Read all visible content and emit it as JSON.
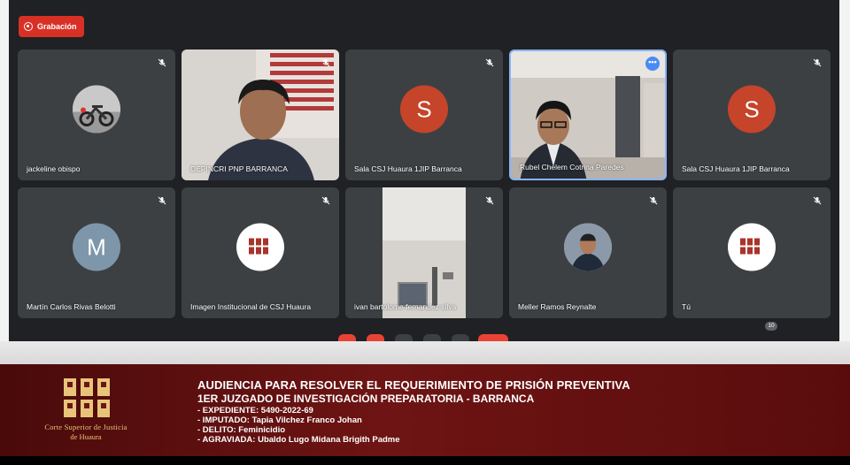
{
  "recording": {
    "label": "Grabación",
    "color": "#d93025"
  },
  "participants": [
    {
      "name": "jackeline obispo",
      "type": "photo-avatar",
      "icon": "motorcycle-photo-icon"
    },
    {
      "name": "DEPINCRI PNP BARRANCA",
      "type": "video"
    },
    {
      "name": "Sala CSJ Huaura 1JIP Barranca",
      "type": "letter",
      "letter": "S"
    },
    {
      "name": "Rubel Chelem Cotrina Paredes",
      "type": "video",
      "active": true
    },
    {
      "name": "Sala CSJ Huaura 1JIP Barranca",
      "type": "letter",
      "letter": "S"
    },
    {
      "name": "Martín Carlos Rivas Belotti",
      "type": "letter",
      "letter": "M"
    },
    {
      "name": "Imagen Institucional de CSJ Huaura",
      "type": "logo-avatar"
    },
    {
      "name": "ivan bartolome fernandez silva",
      "type": "video"
    },
    {
      "name": "Meller Ramos Reynalte",
      "type": "photo-avatar",
      "icon": "person-photo-icon"
    },
    {
      "name": "Tú",
      "type": "logo-avatar"
    }
  ],
  "toolbar": {
    "participant_count": "10"
  },
  "banner": {
    "title": "AUDIENCIA PARA RESOLVER EL REQUERIMIENTO DE PRISIÓN PREVENTIVA",
    "subtitle": "1ER JUZGADO DE INVESTIGACIÓN PREPARATORIA - BARRANCA",
    "expediente": "- EXPEDIENTE: 5490-2022-69",
    "imputado": "- IMPUTADO: Tapia Vilchez Franco Johan",
    "delito": "- DELITO: Feminicidio",
    "agraviada": "- AGRAVIADA: Ubaldo Lugo Midana Brigith Padme",
    "org_line1": "Corte Superior de Justicia",
    "org_line2": "de Huaura",
    "logo_color": "#e8c47a"
  }
}
